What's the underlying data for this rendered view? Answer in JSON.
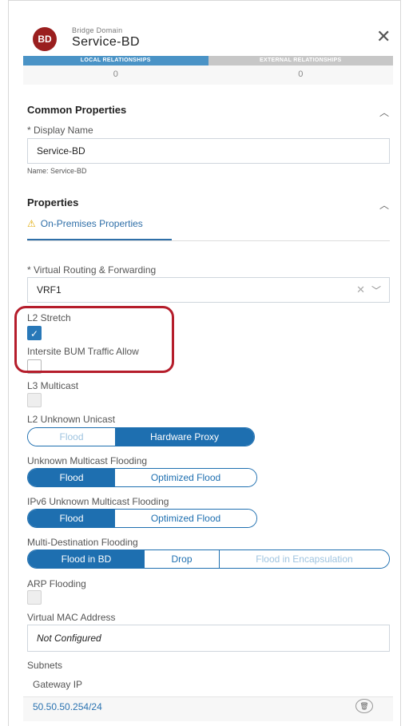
{
  "header": {
    "badge": "BD",
    "subtitle": "Bridge Domain",
    "title": "Service-BD",
    "close": "✕"
  },
  "tabs": [
    {
      "label": "LOCAL RELATIONSHIPS",
      "count": "0"
    },
    {
      "label": "EXTERNAL RELATIONSHIPS",
      "count": "0"
    }
  ],
  "common": {
    "title": "Common Properties",
    "display_name_label": "* Display Name",
    "display_name_value": "Service-BD",
    "name_note": "Name: Service-BD"
  },
  "properties": {
    "title": "Properties",
    "tab_label": "On-Premises Properties",
    "vrf_label": "* Virtual Routing & Forwarding",
    "vrf_value": "VRF1",
    "l2_stretch_label": "L2 Stretch",
    "l2_stretch_checked": true,
    "intersite_label": "Intersite BUM Traffic Allow",
    "intersite_checked": false,
    "l3_multicast_label": "L3 Multicast",
    "l2_unknown_label": "L2 Unknown Unicast",
    "l2_unknown_options": [
      "Flood",
      "Hardware Proxy"
    ],
    "l2_unknown_selected": "Hardware Proxy",
    "unknown_mc_label": "Unknown Multicast Flooding",
    "unknown_mc_options": [
      "Flood",
      "Optimized Flood"
    ],
    "unknown_mc_selected": "Flood",
    "ipv6_mc_label": "IPv6 Unknown Multicast Flooding",
    "ipv6_mc_options": [
      "Flood",
      "Optimized Flood"
    ],
    "ipv6_mc_selected": "Flood",
    "multi_dest_label": "Multi-Destination Flooding",
    "multi_dest_options": [
      "Flood in BD",
      "Drop",
      "Flood in Encapsulation"
    ],
    "multi_dest_selected": "Flood in BD",
    "arp_label": "ARP Flooding",
    "vmac_label": "Virtual MAC Address",
    "vmac_value": "Not Configured",
    "subnets_label": "Subnets",
    "gateway_label": "Gateway IP",
    "gateway_value": "50.50.50.254/24"
  },
  "colors": {
    "accent": "#1e6fb0",
    "badge": "#9a1f1f",
    "highlight": "#b51d2b"
  }
}
